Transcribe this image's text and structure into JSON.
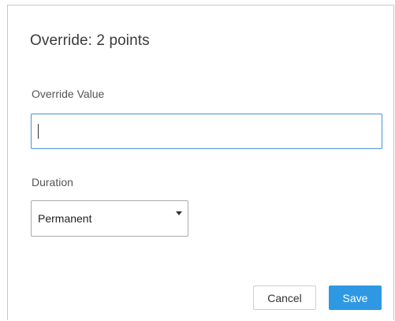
{
  "dialog": {
    "title": "Override: 2 points",
    "override_field": {
      "label": "Override Value",
      "value": ""
    },
    "duration_field": {
      "label": "Duration",
      "selected": "Permanent"
    },
    "buttons": {
      "cancel": "Cancel",
      "save": "Save"
    }
  },
  "colors": {
    "accent": "#2f98e3",
    "focus_border": "#4a90d9"
  }
}
